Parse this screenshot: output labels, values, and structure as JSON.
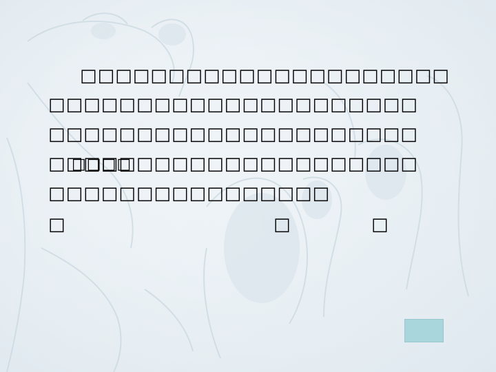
{
  "slide": {
    "background_description_color": "#eaf1f5",
    "text_lines": [
      "□□□□□□□□□□□□□□□□□□□□□",
      "□□□□□□□□□□□□□□□□□□□□□",
      "□□□□□□□□□□□□□□□□□□□□□",
      "□□□□□□□□□□□□□□□□□□□□□",
      "□□□□□□□□□□□□□□□□",
      "□",
      "□",
      "□"
    ],
    "overlay_text": "□□□□",
    "nav_button_color": "#a9d6dc"
  }
}
